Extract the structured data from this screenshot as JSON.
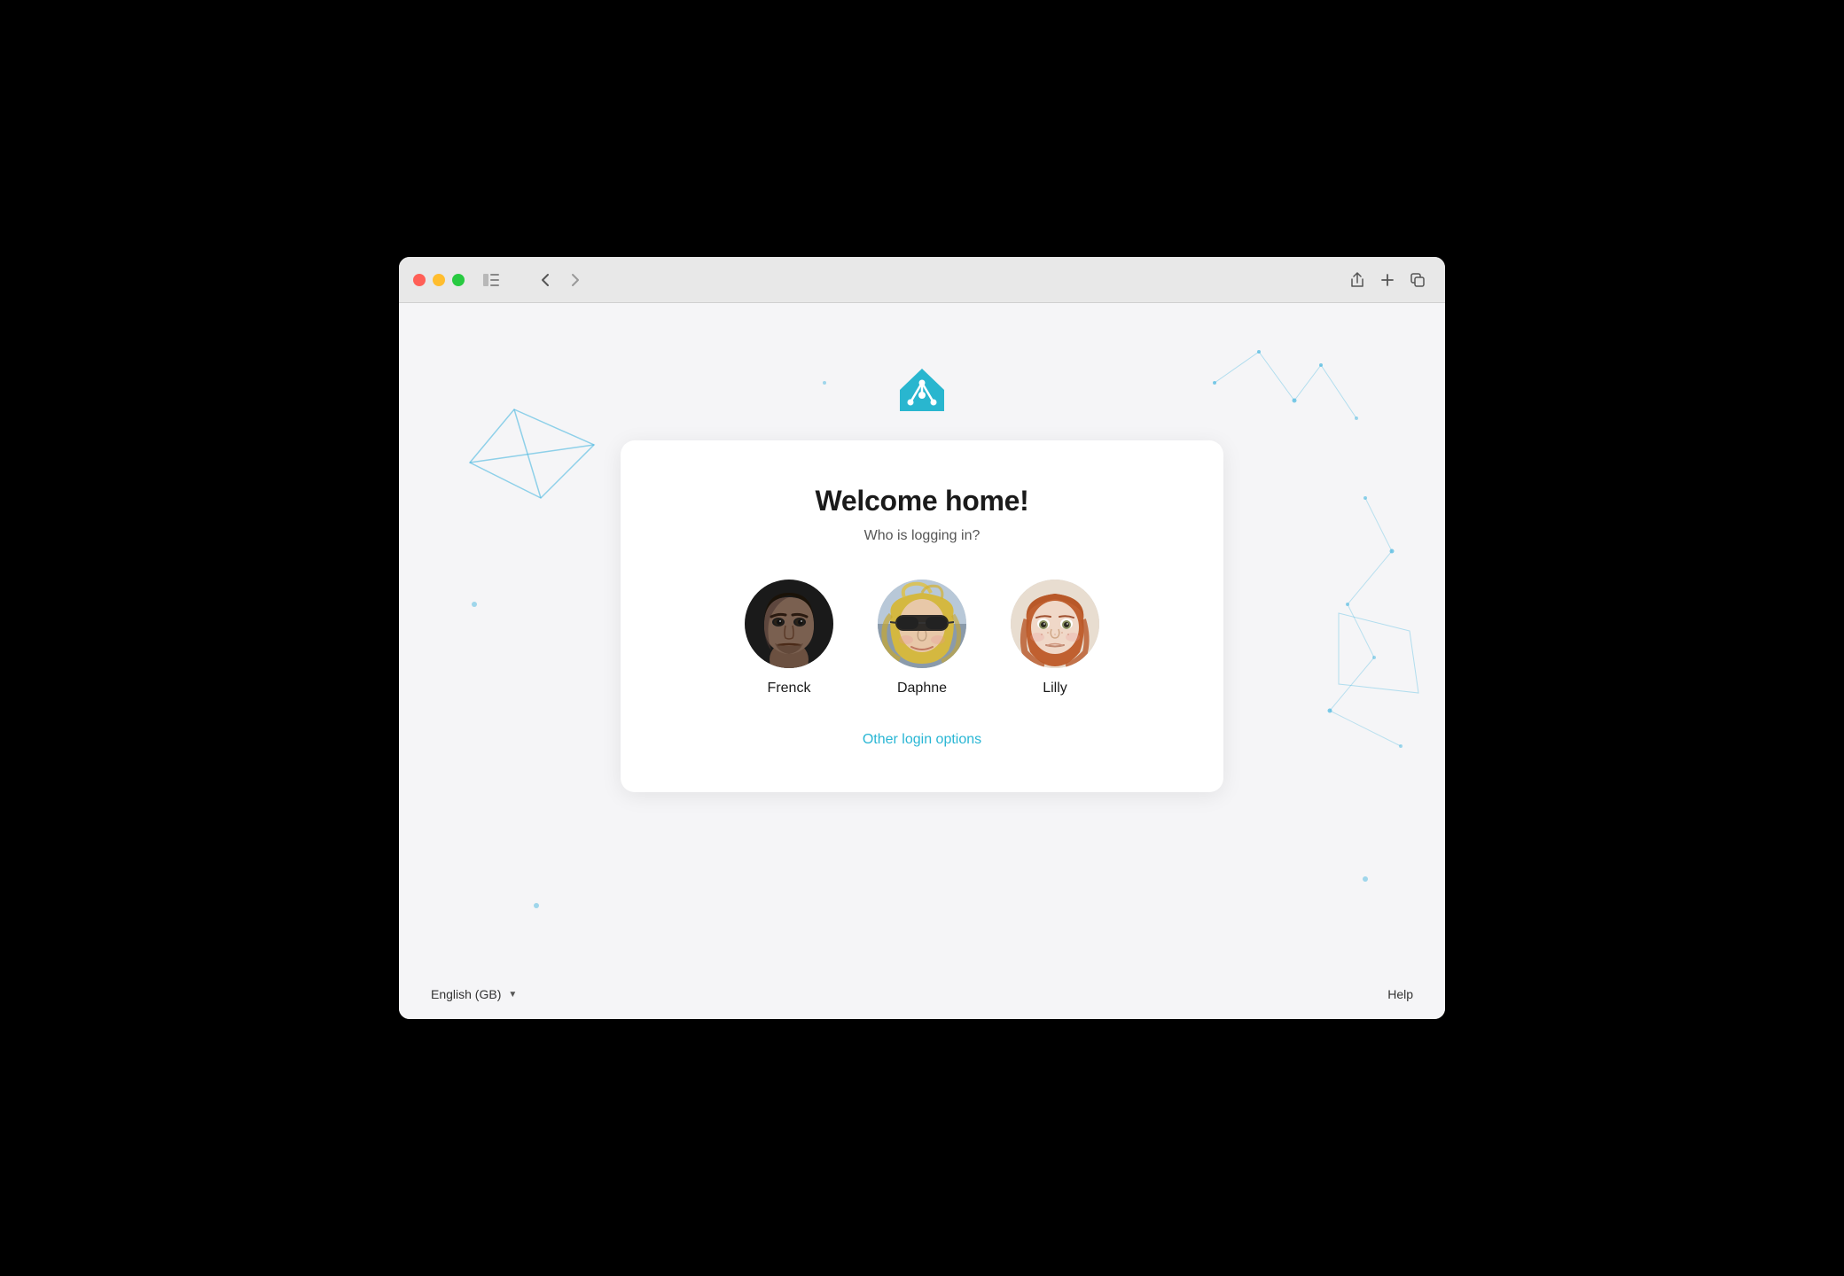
{
  "browser": {
    "traffic_lights": {
      "close_label": "close",
      "minimize_label": "minimize",
      "maximize_label": "maximize"
    },
    "nav": {
      "back_label": "‹",
      "forward_label": "›"
    },
    "right_controls": {
      "share_label": "⬆",
      "new_tab_label": "+",
      "tabs_label": "⧉"
    }
  },
  "page": {
    "logo_alt": "Home Assistant Logo",
    "card": {
      "title": "Welcome home!",
      "subtitle": "Who is logging in?",
      "users": [
        {
          "id": "frenck",
          "name": "Frenck",
          "avatar_type": "frenck"
        },
        {
          "id": "daphne",
          "name": "Daphne",
          "avatar_type": "daphne"
        },
        {
          "id": "lilly",
          "name": "Lilly",
          "avatar_type": "lilly"
        }
      ],
      "other_login_label": "Other login options"
    },
    "footer": {
      "language_label": "English (GB)",
      "help_label": "Help"
    }
  },
  "colors": {
    "accent": "#29b6d4",
    "logo_blue": "#29b6cf"
  }
}
